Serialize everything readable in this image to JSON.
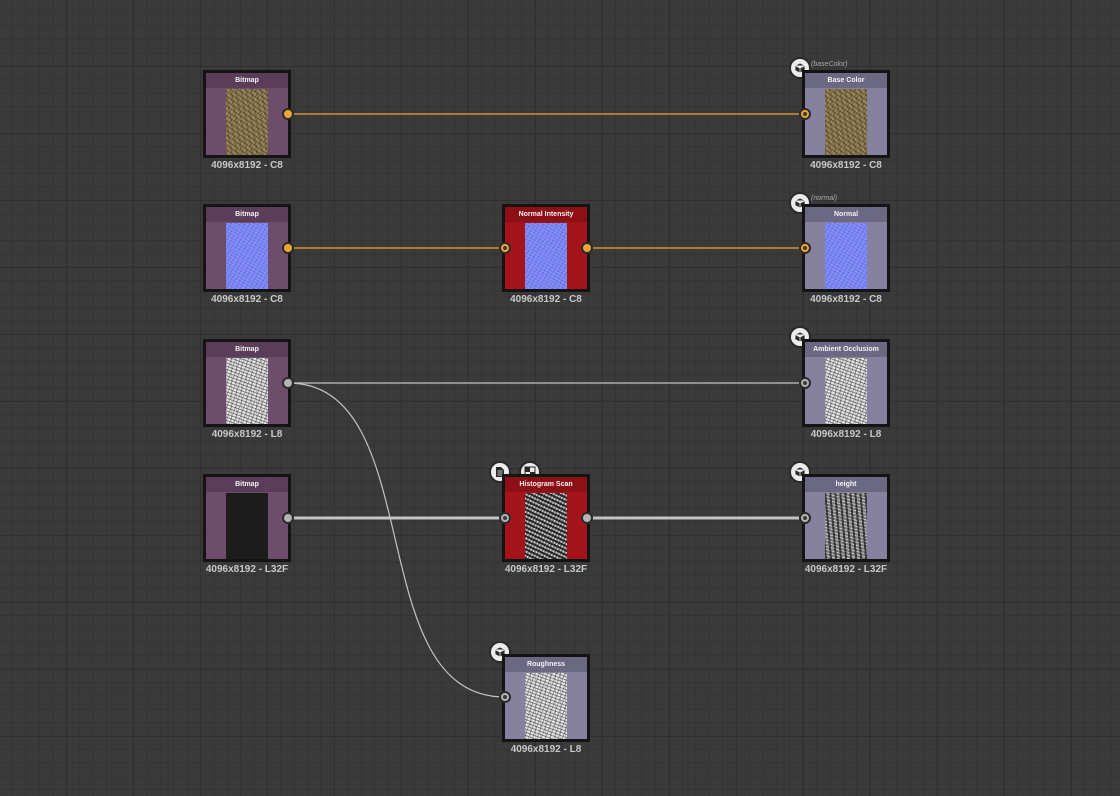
{
  "nodes": {
    "bitmap1": {
      "title": "Bitmap",
      "resolution": "4096x8192 - C8"
    },
    "base_color": {
      "title": "Base Color",
      "resolution": "4096x8192 - C8",
      "usage": "(baseColor)"
    },
    "bitmap2": {
      "title": "Bitmap",
      "resolution": "4096x8192 - C8"
    },
    "normal_intensity": {
      "title": "Normal Intensity",
      "resolution": "4096x8192 - C8"
    },
    "normal": {
      "title": "Normal",
      "resolution": "4096x8192 - C8",
      "usage": "(normal)"
    },
    "bitmap3": {
      "title": "Bitmap",
      "resolution": "4096x8192 - L8"
    },
    "ambient_occlusion": {
      "title": "Ambient Occlusiom",
      "resolution": "4096x8192 - L8"
    },
    "bitmap4": {
      "title": "Bitmap",
      "resolution": "4096x8192 - L32F"
    },
    "histogram_scan": {
      "title": "Histogram Scan",
      "resolution": "4096x8192 - L32F"
    },
    "height": {
      "title": "height",
      "resolution": "4096x8192 - L32F"
    },
    "roughness": {
      "title": "Roughness",
      "resolution": "4096x8192 - L8"
    }
  },
  "colors": {
    "color_wire": "#f0a436",
    "gray_wire": "#c4c4c4",
    "bitmap_node": "#6e4c6c",
    "filter_node": "#a5141b",
    "output_node": "#85819e"
  },
  "icons": {
    "output": "cube-icon",
    "bookmark": "document-icon",
    "pattern": "checker-icon"
  }
}
